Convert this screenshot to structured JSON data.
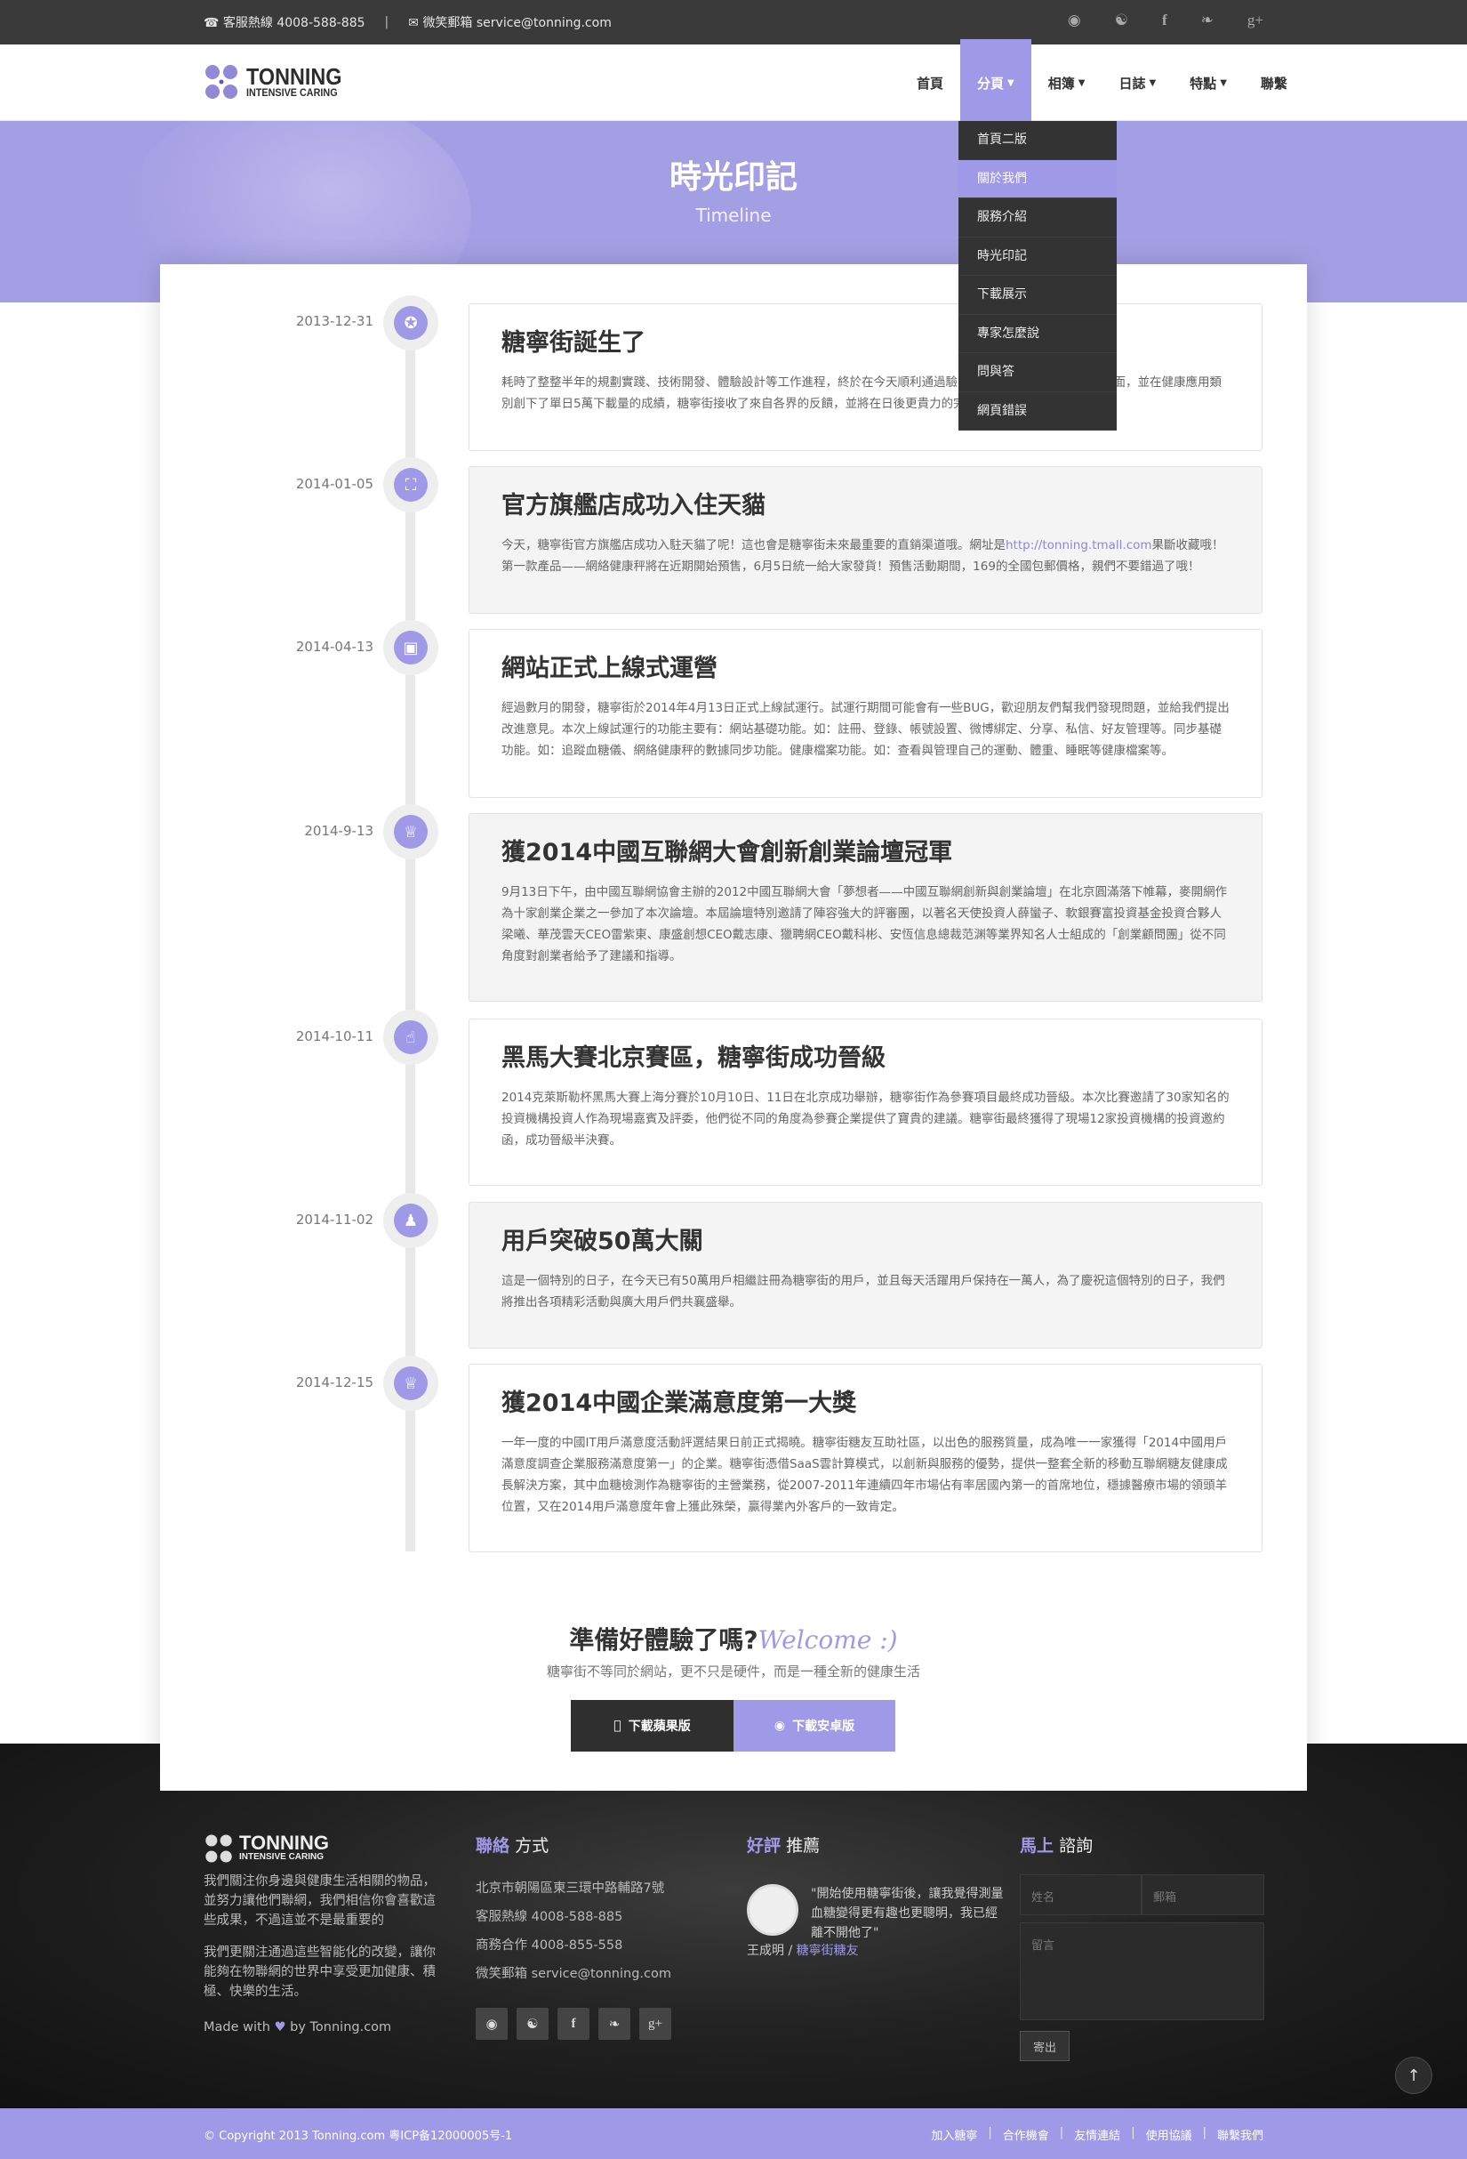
{
  "topbar": {
    "phone": "客服熱線 4008-588-885",
    "separator": "|",
    "email": "微笑郵箱 service@tonning.com",
    "social": [
      "weibo-icon",
      "renren-icon",
      "facebook-icon",
      "twitter-icon",
      "google-plus-icon"
    ]
  },
  "logo": {
    "name": "TONNING",
    "tagline": "INTENSIVE CARING"
  },
  "nav": {
    "items": [
      {
        "label": "首頁"
      },
      {
        "label": "分頁",
        "dropdown": true,
        "active": true
      },
      {
        "label": "相簿",
        "dropdown": true
      },
      {
        "label": "日誌",
        "dropdown": true
      },
      {
        "label": "特點",
        "dropdown": true
      },
      {
        "label": "聯繫"
      }
    ],
    "dropdown_items": [
      "首頁二版",
      "關於我們",
      "服務介紹",
      "時光印記",
      "下載展示",
      "專家怎麼說",
      "問與答",
      "網頁錯誤"
    ],
    "dropdown_active": "關於我們"
  },
  "hero": {
    "title": "時光印記",
    "subtitle": "Timeline"
  },
  "timeline": [
    {
      "date": "2013-12-31",
      "icon": "puzzle-icon",
      "title": "糖寧街誕生了",
      "text": "耗時了整整半年的規劃實踐、技術開發、體驗設計等工作進程，終於在今天順利通過驗收，於今天正式上線與大家見面，並在健康應用類別創下了單日5萬下載量的成績，糖寧街接收了來自各界的反饋，並將在日後更貴力的完善、提升產品品質。"
    },
    {
      "date": "2014-01-05",
      "icon": "cart-icon",
      "title": "官方旗艦店成功入住天貓",
      "text_before": "今天，糖寧街官方旗艦店成功入駐天貓了呢！這也會是糖寧街未來最重要的直銷渠道哦。網址是",
      "link": "http://tonning.tmall.com",
      "text_after": "果斷收藏哦！第一款產品——網絡健康秤將在近期開始預售，6月5日統一給大家發貨！預售活動期間，169的全國包郵價格，親們不要錯過了哦！"
    },
    {
      "date": "2014-04-13",
      "icon": "monitor-icon",
      "title": "網站正式上線式運營",
      "text": "經過數月的開發，糖寧街於2014年4月13日正式上線試運行。試運行期間可能會有一些BUG，歡迎朋友們幫我們發現問題，並給我們提出改進意見。本次上線試運行的功能主要有：網站基礎功能。如：註冊、登錄、帳號設置、微博綁定、分享、私信、好友管理等。同步基礎功能。如：追蹤血糖儀、網絡健康秤的數據同步功能。健康檔案功能。如：查看與管理自己的運動、體重、睡眠等健康檔案等。"
    },
    {
      "date": "2014-9-13",
      "icon": "trophy-icon",
      "title": "獲2014中國互聯網大會創新創業論壇冠軍",
      "text": "9月13日下午，由中國互聯網協會主辦的2012中國互聯網大會「夢想者——中國互聯網創新與創業論壇」在北京圓滿落下帷幕，麥開網作為十家創業企業之一參加了本次論壇。本屆論壇特別邀請了陣容強大的評審團，以著名天使投資人薛蠻子、軟銀賽富投資基金投資合夥人梁曦、華茂雲天CEO雷紫東、康盛創想CEO戴志康、獵聘網CEO戴科彬、安恆信息總裁范渊等業界知名人士組成的「創業顧問團」從不同角度對創業者給予了建議和指導。"
    },
    {
      "date": "2014-10-11",
      "icon": "thumbs-up-icon",
      "title": "黑馬大賽北京賽區，糖寧街成功晉級",
      "text": "2014克萊斯勒杯黑馬大賽上海分賽於10月10日、11日在北京成功舉辦，糖寧街作為參賽項目最終成功晉級。本次比賽邀請了30家知名的投資機構投資人作為現場嘉賓及評委，他們從不同的角度為參賽企業提供了寶貴的建議。糖寧街最終獲得了現場12家投資機構的投資邀約函，成功晉級半決賽。"
    },
    {
      "date": "2014-11-02",
      "icon": "person-icon",
      "title": "用戶突破50萬大關",
      "text": "這是一個特別的日子，在今天已有50萬用戶相繼註冊為糖寧街的用戶，並且每天活躍用戶保持在一萬人，為了慶祝這個特別的日子，我們將推出各項精彩活動與廣大用戶們共襄盛舉。"
    },
    {
      "date": "2014-12-15",
      "icon": "trophy-icon",
      "title": "獲2014中國企業滿意度第一大獎",
      "text": "一年一度的中國IT用戶滿意度活動評選結果日前正式揭曉。糖寧街糖友互助社區，以出色的服務質量，成為唯一一家獲得「2014中國用戶滿意度調查企業服務滿意度第一」的企業。糖寧街憑借SaaS雲計算模式，以創新與服務的優勢，提供一整套全新的移動互聯網糖友健康成長解決方案，其中血糖檢測作為糖寧街的主營業務，從2007-2011年連續四年市場佔有率居國內第一的首席地位，穩據醫療市場的領頭羊位置，又在2014用戶滿意度年會上獲此殊榮，贏得業內外客戶的一致肯定。"
    }
  ],
  "cta": {
    "title": "準備好體驗了嗎?",
    "welcome": "Welcome :)",
    "subtitle": "糖寧街不等同於網站，更不只是硬件，而是一種全新的健康生活",
    "apple_label": "下載蘋果版",
    "android_label": "下載安卓版"
  },
  "footer": {
    "about": {
      "logo_name": "TONNING",
      "logo_tagline": "INTENSIVE CARING",
      "p1": "我們關注你身邊與健康生活相關的物品，並努力讓他們聯網，我們相信你會喜歡這些成果，不過這並不是最重要的",
      "p2": "我們更關注通過這些智能化的改變，讓你能夠在物聯網的世界中享受更加健康、積極、快樂的生活。",
      "made_with": "Made with",
      "by": "by Tonning.com"
    },
    "contact": {
      "title_em": "聯絡",
      "title_rest": "方式",
      "address": "北京市朝陽區東三環中路輔路7號",
      "phone": "客服熱線 4008-588-885",
      "business": "商務合作 4008-855-558",
      "email": "微笑郵箱 service@tonning.com",
      "social": [
        "weibo-icon",
        "renren-icon",
        "facebook-icon",
        "twitter-icon",
        "google-plus-icon"
      ]
    },
    "review": {
      "title_em": "好評",
      "title_rest": "推薦",
      "quote": "\"開始使用糖寧街後，讓我覺得測量血糖變得更有趣也更聰明，我已經離不開他了\"",
      "author": "王成明 /",
      "author_tag": "糖寧街糖友"
    },
    "inquiry": {
      "title_em": "馬上",
      "title_rest": "諮詢",
      "name_placeholder": "姓名",
      "email_placeholder": "郵箱",
      "message_placeholder": "留言",
      "send_label": "寄出"
    }
  },
  "bottombar": {
    "copyright": "© Copyright 2013 Tonning.com 粵ICP备12000005号-1",
    "links": [
      "加入糖寧",
      "合作機會",
      "友情連結",
      "使用協議",
      "聯繫我們"
    ]
  },
  "colors": {
    "accent": "#9f99e8",
    "topbar": "#3a3a3a",
    "dark": "#2f2f2f"
  }
}
